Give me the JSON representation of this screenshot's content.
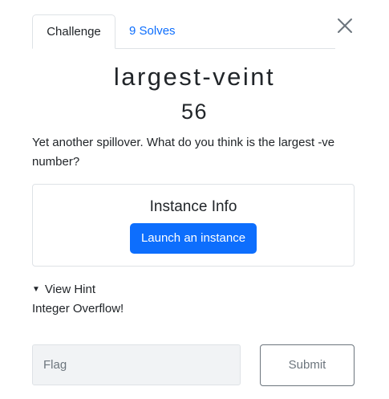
{
  "tabs": {
    "challenge_label": "Challenge",
    "solves_label": "9 Solves"
  },
  "challenge": {
    "name": "largest-veint",
    "points": "56",
    "description": "Yet another spillover. What do you think is the largest -ve number?"
  },
  "instance": {
    "title": "Instance Info",
    "launch_label": "Launch an instance"
  },
  "hint": {
    "toggle_label": "View Hint",
    "content": "Integer Overflow!"
  },
  "flag_form": {
    "placeholder": "Flag",
    "value": "",
    "submit_label": "Submit"
  },
  "icons": {
    "close": "close-icon",
    "hint_toggle": "triangle-down-icon"
  },
  "colors": {
    "primary": "#0d6efd",
    "border": "#dee2e6",
    "muted": "#6c757d",
    "input_bg": "#f1f3f5"
  }
}
